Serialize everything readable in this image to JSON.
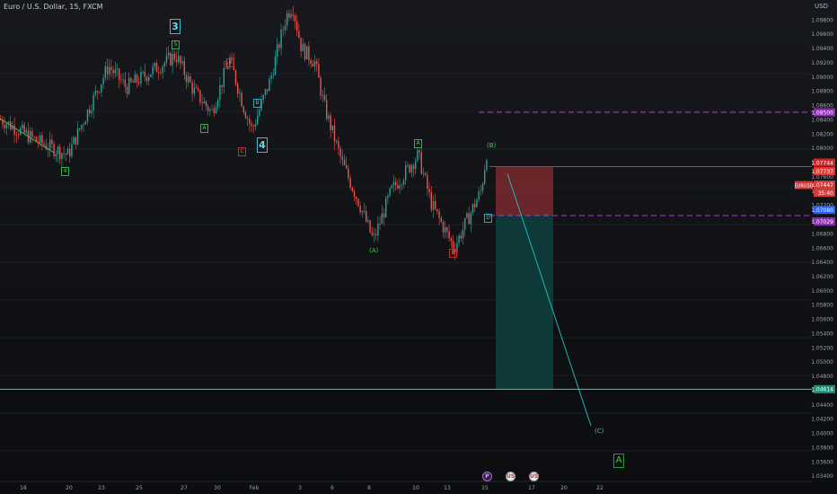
{
  "header": {
    "title": "Euro / U.S. Dollar, 15, FXCM",
    "currency": "USD"
  },
  "colors": {
    "candle_up": "#26a69a",
    "candle_down": "#ef5350",
    "price_line_red": "#ff1f1f",
    "dashed_purple": "#b43bd1",
    "target_line": "#4cc9a0",
    "stop_zone": "#7a2a2e",
    "target_zone": "#0d3f3c",
    "projection_line": "#23b8b0"
  },
  "waves": {
    "big_3": "3",
    "big_4": "4",
    "small_5": "5",
    "small_4_left": "4",
    "small_A_left": "A",
    "small_A_mid": "A",
    "red_B_top": "B",
    "red_C_left": "C",
    "red_B_bottom": "B",
    "cyan_D": "D",
    "cyan_B_mid": "B",
    "label_A_paren": "(A)",
    "label_B_paren": "(B)",
    "label_C_paren": "(C)",
    "A_big_bottom": "A"
  },
  "events": {
    "p": "P",
    "us1": "US",
    "us2": "US"
  },
  "chart_data": {
    "type": "candlestick",
    "x_ticks": [
      "18",
      "20",
      "23",
      "25",
      "27",
      "30",
      "Feb",
      "3",
      "6",
      "8",
      "10",
      "13",
      "15",
      "17",
      "20",
      "22"
    ],
    "y_ticks": [
      "1.09800",
      "1.09600",
      "1.09400",
      "1.09200",
      "1.09000",
      "1.08800",
      "1.08600",
      "1.08400",
      "1.08200",
      "1.08000",
      "1.07800",
      "1.07600",
      "1.07400",
      "1.07200",
      "1.07000",
      "1.06800",
      "1.06600",
      "1.06400",
      "1.06200",
      "1.06000",
      "1.05800",
      "1.05600",
      "1.05400",
      "1.05200",
      "1.05000",
      "1.04800",
      "1.04600",
      "1.04400",
      "1.04200",
      "1.04000",
      "1.03800",
      "1.03600",
      "1.03400"
    ],
    "ylim": [
      1.0332,
      1.1
    ],
    "price_labels": {
      "top_purple": "1.08500",
      "red_1": "1.07744",
      "red_2": "1.07737",
      "current_a": "1.07447",
      "current_b": "35:40",
      "current_tag": "EURUSD",
      "blue": "1.07080",
      "purple_low": "1.07029",
      "target": "1.04614"
    },
    "levels": {
      "entry": 1.07737,
      "upper_dashed": 1.085,
      "stop_bottom": 1.0705,
      "lower_dashed": 1.0705,
      "target": 1.04614
    },
    "path": [
      [
        0,
        1.084
      ],
      [
        40,
        1.081
      ],
      [
        75,
        1.079
      ],
      [
        100,
        1.086
      ],
      [
        120,
        1.0915
      ],
      [
        140,
        1.0885
      ],
      [
        165,
        1.0905
      ],
      [
        195,
        1.093
      ],
      [
        215,
        1.088
      ],
      [
        235,
        1.085
      ],
      [
        255,
        1.0925
      ],
      [
        270,
        1.086
      ],
      [
        280,
        1.0825
      ],
      [
        300,
        1.0895
      ],
      [
        318,
        1.0985
      ],
      [
        325,
        1.1
      ],
      [
        335,
        1.094
      ],
      [
        350,
        1.092
      ],
      [
        360,
        1.086
      ],
      [
        380,
        1.078
      ],
      [
        400,
        1.072
      ],
      [
        415,
        1.067
      ],
      [
        435,
        1.074
      ],
      [
        465,
        1.079
      ],
      [
        480,
        1.072
      ],
      [
        505,
        1.066
      ],
      [
        520,
        1.07
      ],
      [
        535,
        1.074
      ],
      [
        542,
        1.08
      ]
    ],
    "projection": [
      [
        565,
        1.0764
      ],
      [
        658,
        1.041
      ]
    ]
  }
}
